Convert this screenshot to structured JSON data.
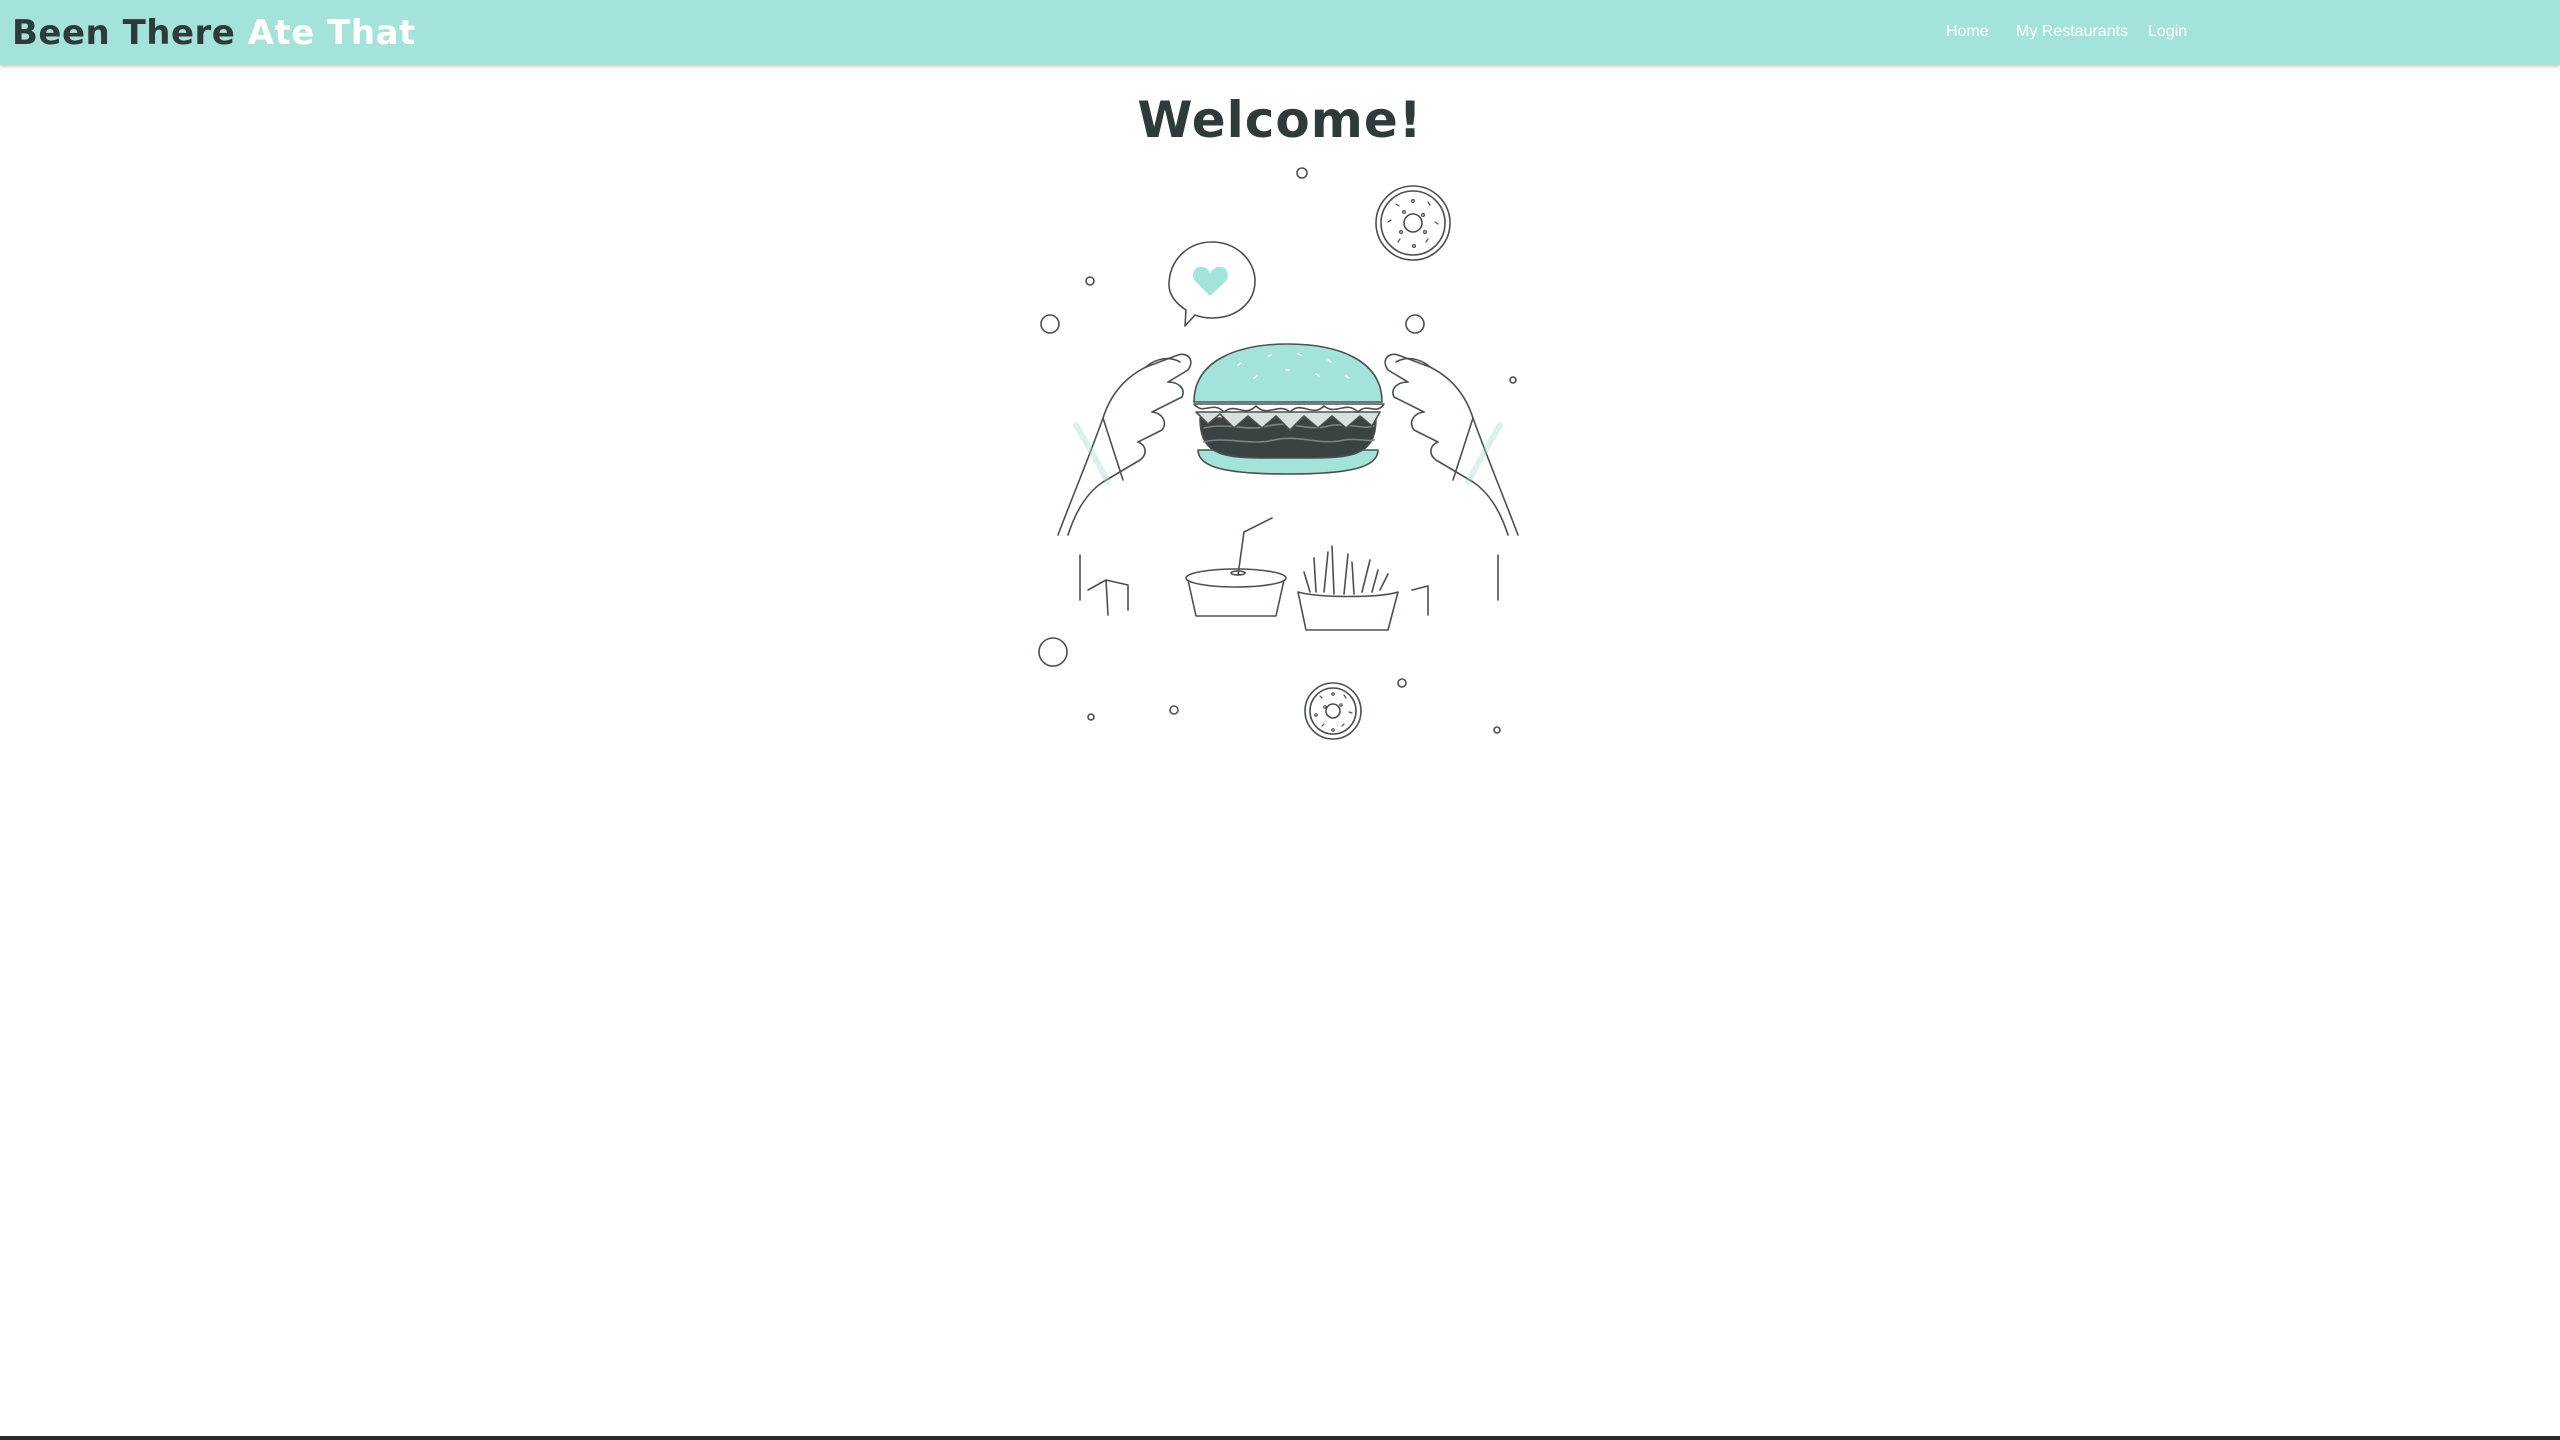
{
  "navbar": {
    "brand_part1": "Been There",
    "brand_part2": "Ate That",
    "links": [
      {
        "label": "Home"
      },
      {
        "label": "My Restaurants"
      },
      {
        "label": "Login"
      }
    ]
  },
  "main": {
    "heading": "Welcome!",
    "hero_illustration": "burger-eating-illustration"
  },
  "colors": {
    "accent": "#a4e3d9",
    "text_dark": "#2f3a3a",
    "line_art": "#4a5050"
  }
}
